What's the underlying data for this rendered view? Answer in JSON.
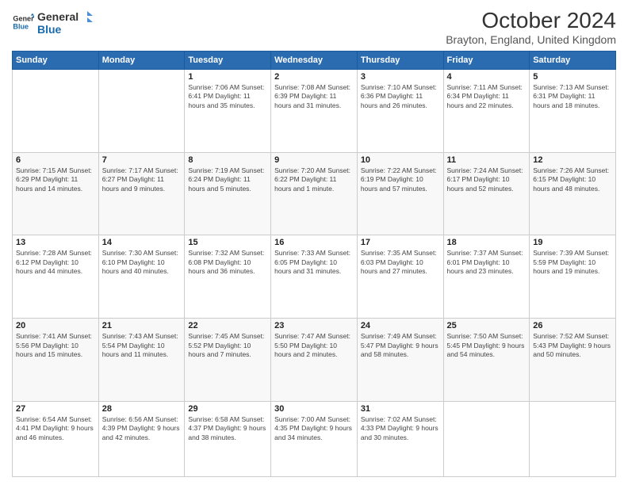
{
  "header": {
    "logo_line1": "General",
    "logo_line2": "Blue",
    "month_title": "October 2024",
    "location": "Brayton, England, United Kingdom"
  },
  "days_of_week": [
    "Sunday",
    "Monday",
    "Tuesday",
    "Wednesday",
    "Thursday",
    "Friday",
    "Saturday"
  ],
  "weeks": [
    [
      {
        "day": "",
        "content": ""
      },
      {
        "day": "",
        "content": ""
      },
      {
        "day": "1",
        "content": "Sunrise: 7:06 AM\nSunset: 6:41 PM\nDaylight: 11 hours and 35 minutes."
      },
      {
        "day": "2",
        "content": "Sunrise: 7:08 AM\nSunset: 6:39 PM\nDaylight: 11 hours and 31 minutes."
      },
      {
        "day": "3",
        "content": "Sunrise: 7:10 AM\nSunset: 6:36 PM\nDaylight: 11 hours and 26 minutes."
      },
      {
        "day": "4",
        "content": "Sunrise: 7:11 AM\nSunset: 6:34 PM\nDaylight: 11 hours and 22 minutes."
      },
      {
        "day": "5",
        "content": "Sunrise: 7:13 AM\nSunset: 6:31 PM\nDaylight: 11 hours and 18 minutes."
      }
    ],
    [
      {
        "day": "6",
        "content": "Sunrise: 7:15 AM\nSunset: 6:29 PM\nDaylight: 11 hours and 14 minutes."
      },
      {
        "day": "7",
        "content": "Sunrise: 7:17 AM\nSunset: 6:27 PM\nDaylight: 11 hours and 9 minutes."
      },
      {
        "day": "8",
        "content": "Sunrise: 7:19 AM\nSunset: 6:24 PM\nDaylight: 11 hours and 5 minutes."
      },
      {
        "day": "9",
        "content": "Sunrise: 7:20 AM\nSunset: 6:22 PM\nDaylight: 11 hours and 1 minute."
      },
      {
        "day": "10",
        "content": "Sunrise: 7:22 AM\nSunset: 6:19 PM\nDaylight: 10 hours and 57 minutes."
      },
      {
        "day": "11",
        "content": "Sunrise: 7:24 AM\nSunset: 6:17 PM\nDaylight: 10 hours and 52 minutes."
      },
      {
        "day": "12",
        "content": "Sunrise: 7:26 AM\nSunset: 6:15 PM\nDaylight: 10 hours and 48 minutes."
      }
    ],
    [
      {
        "day": "13",
        "content": "Sunrise: 7:28 AM\nSunset: 6:12 PM\nDaylight: 10 hours and 44 minutes."
      },
      {
        "day": "14",
        "content": "Sunrise: 7:30 AM\nSunset: 6:10 PM\nDaylight: 10 hours and 40 minutes."
      },
      {
        "day": "15",
        "content": "Sunrise: 7:32 AM\nSunset: 6:08 PM\nDaylight: 10 hours and 36 minutes."
      },
      {
        "day": "16",
        "content": "Sunrise: 7:33 AM\nSunset: 6:05 PM\nDaylight: 10 hours and 31 minutes."
      },
      {
        "day": "17",
        "content": "Sunrise: 7:35 AM\nSunset: 6:03 PM\nDaylight: 10 hours and 27 minutes."
      },
      {
        "day": "18",
        "content": "Sunrise: 7:37 AM\nSunset: 6:01 PM\nDaylight: 10 hours and 23 minutes."
      },
      {
        "day": "19",
        "content": "Sunrise: 7:39 AM\nSunset: 5:59 PM\nDaylight: 10 hours and 19 minutes."
      }
    ],
    [
      {
        "day": "20",
        "content": "Sunrise: 7:41 AM\nSunset: 5:56 PM\nDaylight: 10 hours and 15 minutes."
      },
      {
        "day": "21",
        "content": "Sunrise: 7:43 AM\nSunset: 5:54 PM\nDaylight: 10 hours and 11 minutes."
      },
      {
        "day": "22",
        "content": "Sunrise: 7:45 AM\nSunset: 5:52 PM\nDaylight: 10 hours and 7 minutes."
      },
      {
        "day": "23",
        "content": "Sunrise: 7:47 AM\nSunset: 5:50 PM\nDaylight: 10 hours and 2 minutes."
      },
      {
        "day": "24",
        "content": "Sunrise: 7:49 AM\nSunset: 5:47 PM\nDaylight: 9 hours and 58 minutes."
      },
      {
        "day": "25",
        "content": "Sunrise: 7:50 AM\nSunset: 5:45 PM\nDaylight: 9 hours and 54 minutes."
      },
      {
        "day": "26",
        "content": "Sunrise: 7:52 AM\nSunset: 5:43 PM\nDaylight: 9 hours and 50 minutes."
      }
    ],
    [
      {
        "day": "27",
        "content": "Sunrise: 6:54 AM\nSunset: 4:41 PM\nDaylight: 9 hours and 46 minutes."
      },
      {
        "day": "28",
        "content": "Sunrise: 6:56 AM\nSunset: 4:39 PM\nDaylight: 9 hours and 42 minutes."
      },
      {
        "day": "29",
        "content": "Sunrise: 6:58 AM\nSunset: 4:37 PM\nDaylight: 9 hours and 38 minutes."
      },
      {
        "day": "30",
        "content": "Sunrise: 7:00 AM\nSunset: 4:35 PM\nDaylight: 9 hours and 34 minutes."
      },
      {
        "day": "31",
        "content": "Sunrise: 7:02 AM\nSunset: 4:33 PM\nDaylight: 9 hours and 30 minutes."
      },
      {
        "day": "",
        "content": ""
      },
      {
        "day": "",
        "content": ""
      }
    ]
  ]
}
